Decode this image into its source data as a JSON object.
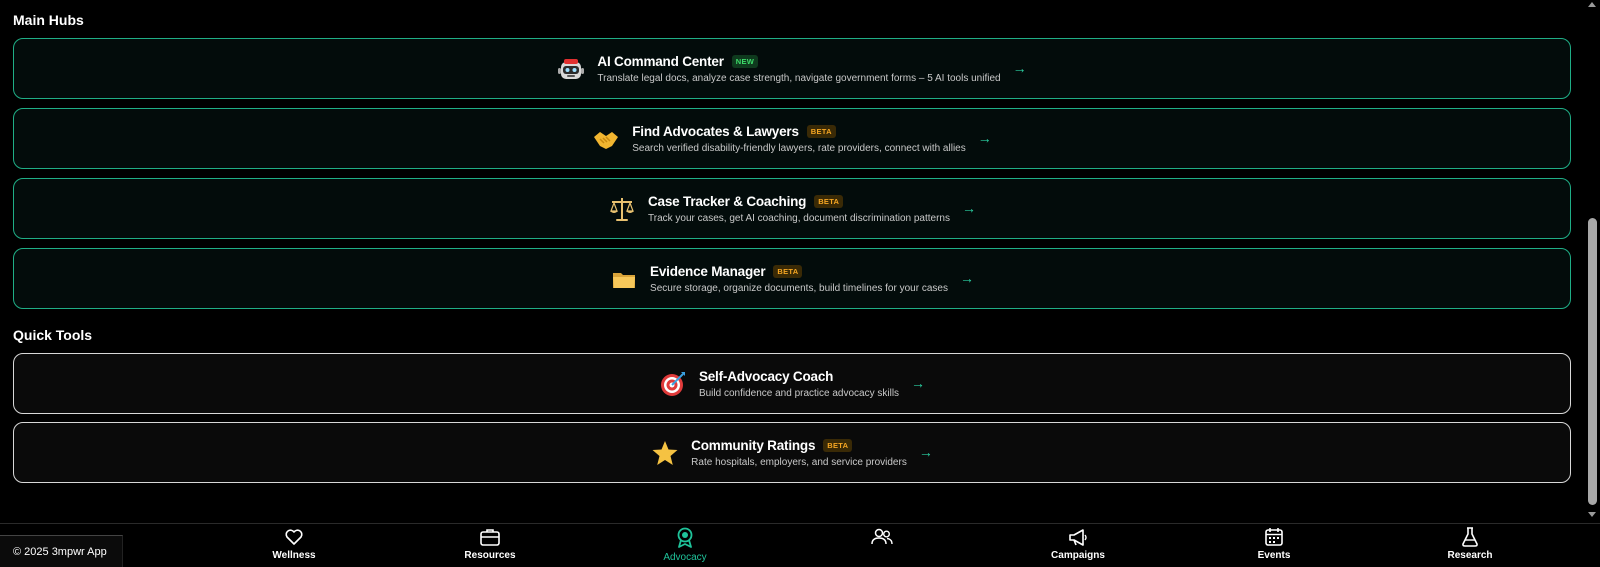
{
  "sections": {
    "main_hubs_title": "Main Hubs",
    "quick_tools_title": "Quick Tools"
  },
  "hubs": [
    {
      "title": "AI Command Center",
      "badge": "NEW",
      "description": "Translate legal docs, analyze case strength, navigate government forms – 5 AI tools unified",
      "icon": "robot-icon",
      "arrow": "→"
    },
    {
      "title": "Find Advocates & Lawyers",
      "badge": "BETA",
      "description": "Search verified disability-friendly lawyers, rate providers, connect with allies",
      "icon": "handshake-icon",
      "arrow": "→"
    },
    {
      "title": "Case Tracker & Coaching",
      "badge": "BETA",
      "description": "Track your cases, get AI coaching, document discrimination patterns",
      "icon": "scales-icon",
      "arrow": "→"
    },
    {
      "title": "Evidence Manager",
      "badge": "BETA",
      "description": "Secure storage, organize documents, build timelines for your cases",
      "icon": "folder-icon",
      "arrow": "→"
    }
  ],
  "tools": [
    {
      "title": "Self-Advocacy Coach",
      "badge": "",
      "description": "Build confidence and practice advocacy skills",
      "icon": "target-icon",
      "arrow": "→"
    },
    {
      "title": "Community Ratings",
      "badge": "BETA",
      "description": "Rate hospitals, employers, and service providers",
      "icon": "star-icon",
      "arrow": "→"
    }
  ],
  "footer": {
    "copyright": "© 2025 3mpwr App"
  },
  "nav": [
    {
      "label": "Wellness",
      "icon": "heart-icon",
      "active": false
    },
    {
      "label": "Resources",
      "icon": "briefcase-icon",
      "active": false
    },
    {
      "label": "Advocacy",
      "icon": "award-icon",
      "active": true
    },
    {
      "label": "",
      "icon": "users-icon",
      "active": false
    },
    {
      "label": "Campaigns",
      "icon": "megaphone-icon",
      "active": false
    },
    {
      "label": "Events",
      "icon": "calendar-icon",
      "active": false
    },
    {
      "label": "Research",
      "icon": "flask-icon",
      "active": false
    }
  ],
  "colors": {
    "accent": "#1fc39a",
    "hub_border": "#1fae86",
    "beta": "#f5a623",
    "new": "#3ddc6a"
  }
}
